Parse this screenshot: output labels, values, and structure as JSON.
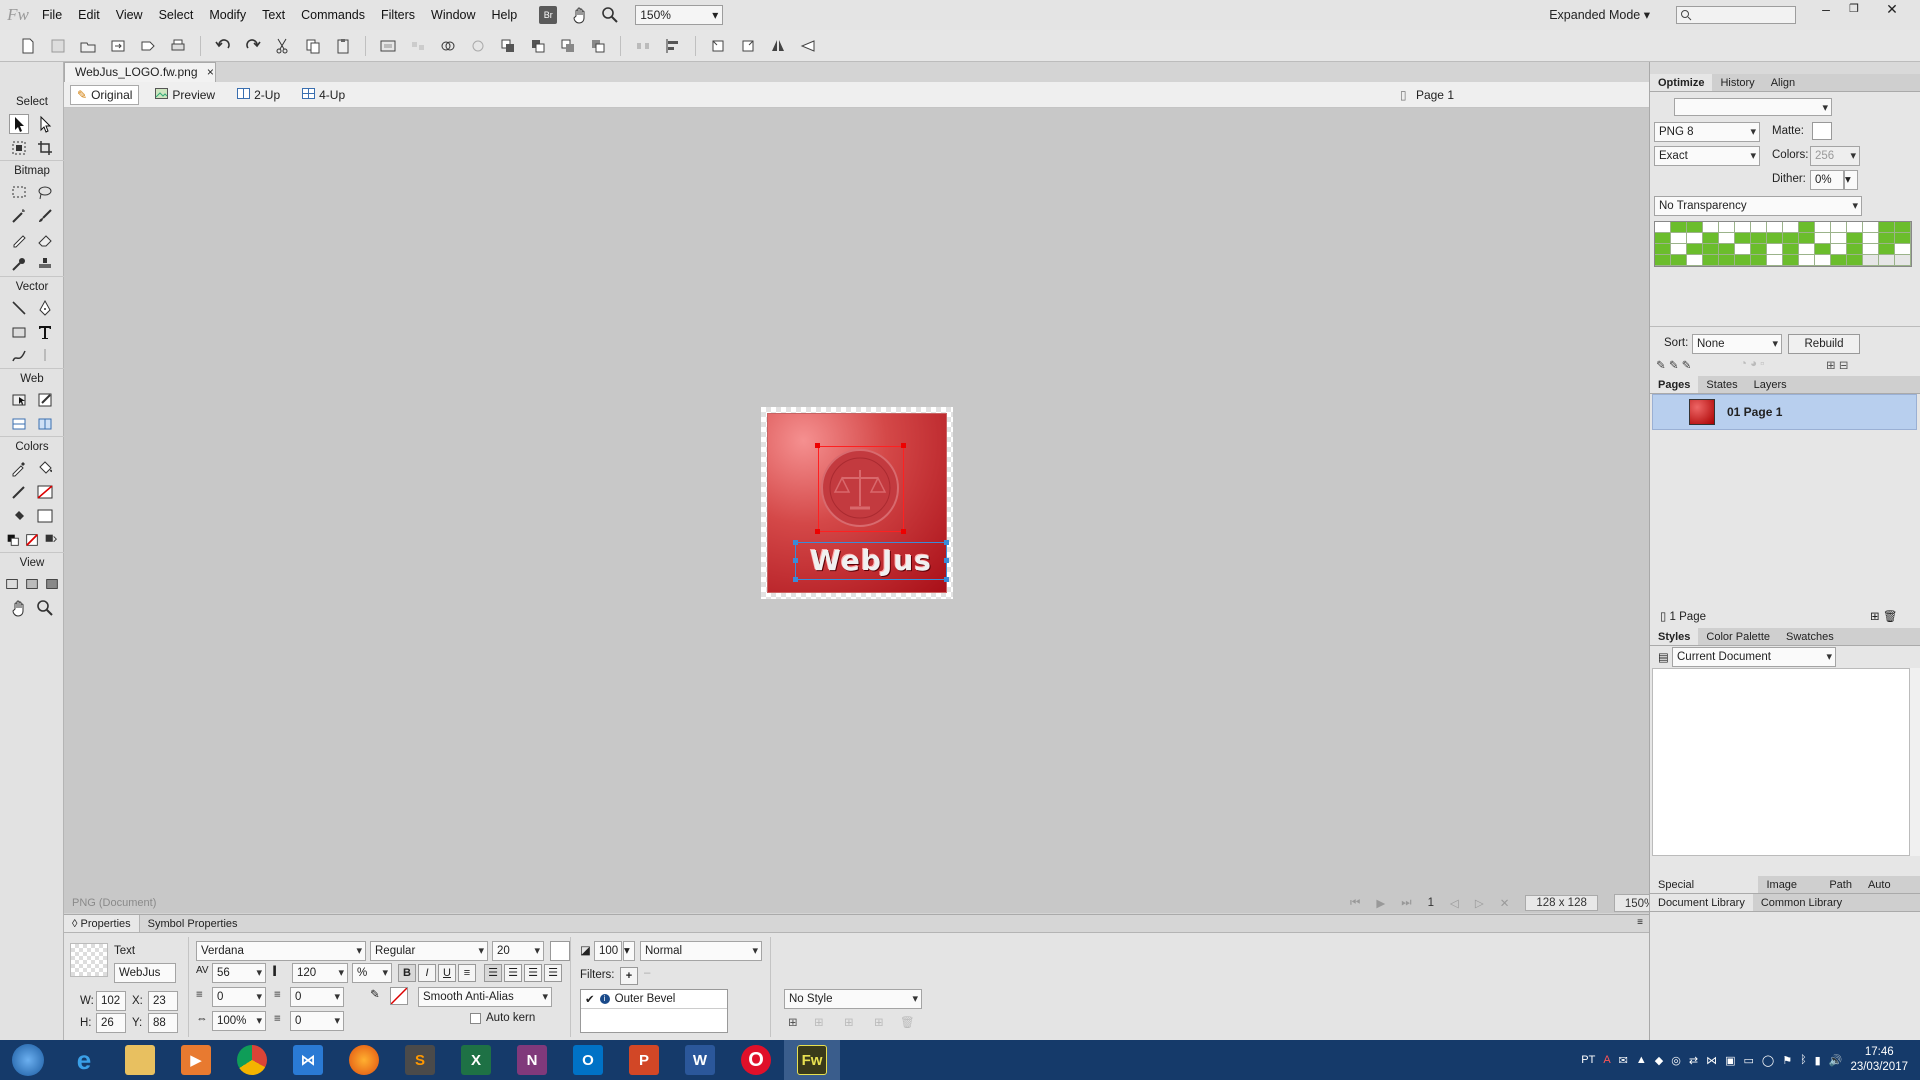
{
  "menu": [
    "File",
    "Edit",
    "View",
    "Select",
    "Modify",
    "Text",
    "Commands",
    "Filters",
    "Window",
    "Help"
  ],
  "app_logo": "Fw",
  "bridge_label": "Br",
  "zoom": "150%",
  "workspace_mode": "Expanded Mode",
  "document_tab": "WebJus_LOGO.fw.png",
  "view_tabs": [
    "Original",
    "Preview",
    "2-Up",
    "4-Up"
  ],
  "page_selector": "Page 1",
  "tools_sections": {
    "select": "Select",
    "bitmap": "Bitmap",
    "vector": "Vector",
    "web": "Web",
    "colors": "Colors",
    "view": "View"
  },
  "canvas": {
    "logo_text": "WebJus",
    "status": "PNG (Document)"
  },
  "pager": {
    "page": "1",
    "dims": "128 x 128",
    "zoom": "150%"
  },
  "properties": {
    "tabs": [
      "Properties",
      "Symbol Properties"
    ],
    "object_type": "Text",
    "object_name": "WebJus",
    "font": "Verdana",
    "style": "Regular",
    "size": "20",
    "kerning": "56",
    "leading": "120",
    "leading_unit": "%",
    "indent": "0",
    "space_before": "0",
    "space_after": "0",
    "scale": "100%",
    "anti_alias": "Smooth Anti-Alias",
    "auto_kern": "Auto kern",
    "opacity": "100",
    "blend": "Normal",
    "filters_label": "Filters:",
    "filter_item": "Outer Bevel",
    "style_select": "No Style",
    "w_label": "W:",
    "w": "102",
    "h_label": "H:",
    "h": "26",
    "x_label": "X:",
    "x": "23",
    "y_label": "Y:",
    "y": "88",
    "bold": "B",
    "italic": "I",
    "underline": "U"
  },
  "optimize": {
    "tabs": [
      "Optimize",
      "History",
      "Align"
    ],
    "format": "PNG 8",
    "matte_label": "Matte:",
    "palette": "Exact",
    "colors_label": "Colors:",
    "colors": "256",
    "dither_label": "Dither:",
    "dither": "0%",
    "transparency": "No Transparency",
    "sort_label": "Sort:",
    "sort": "None",
    "rebuild": "Rebuild"
  },
  "pages": {
    "tabs": [
      "Pages",
      "States",
      "Layers"
    ],
    "item": "01  Page 1",
    "count": "1 Page"
  },
  "styles": {
    "tabs": [
      "Styles",
      "Color Palette",
      "Swatches"
    ],
    "library": "Current Document"
  },
  "bottom_tabs1": [
    "Special Characters",
    "Image Ed",
    "Path",
    "Auto Sha"
  ],
  "bottom_tabs2": [
    "Document Library",
    "Common Library"
  ],
  "taskbar": {
    "lang": "PT",
    "time": "17:46",
    "date": "23/03/2017",
    "apps": [
      "IE",
      "Explorer",
      "Media",
      "Chrome",
      "VS",
      "Firefox",
      "Sublime",
      "Excel",
      "OneNote",
      "Outlook",
      "PowerPoint",
      "Word",
      "Opera",
      "Fireworks"
    ]
  },
  "colors": {
    "accent_red": "#b0121a",
    "selection_blue": "#3a8bd8",
    "palette_green": "#6bbd2c",
    "taskbar": "#153a6a"
  }
}
